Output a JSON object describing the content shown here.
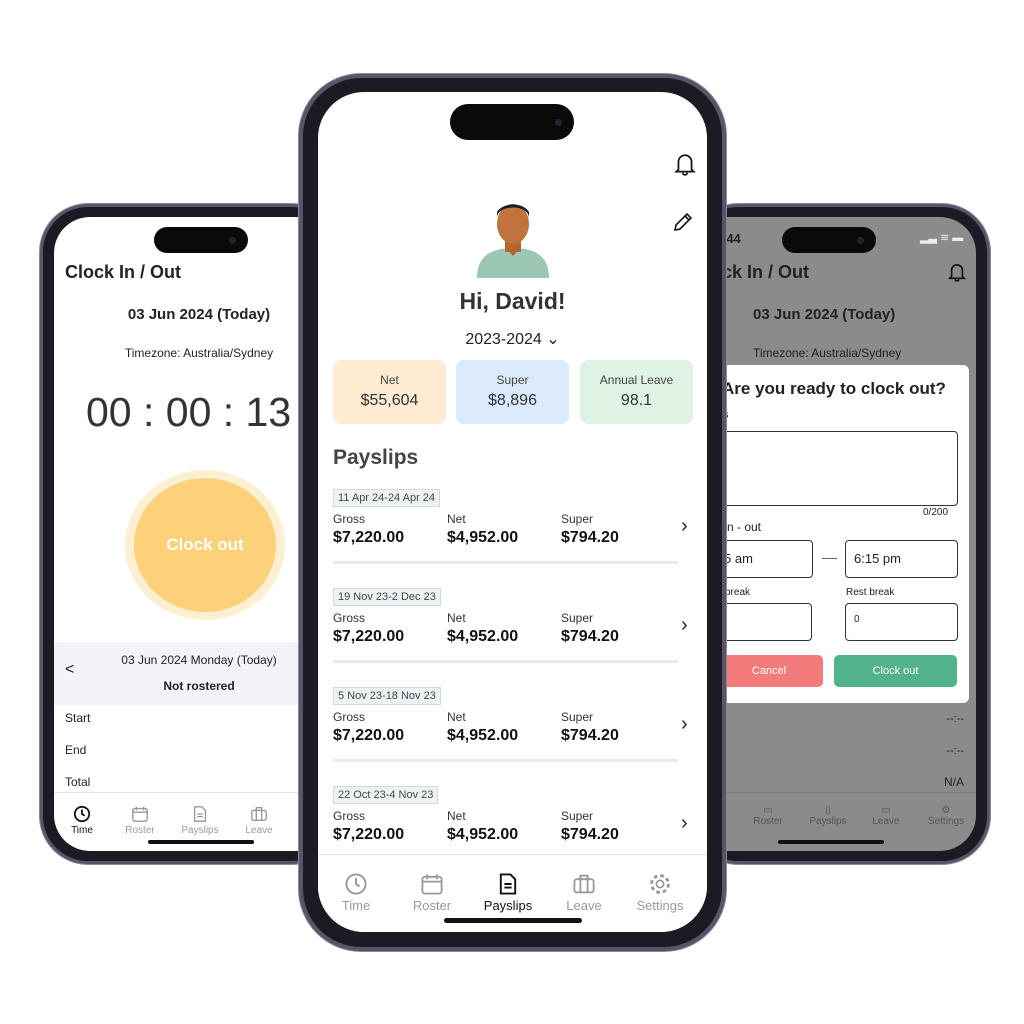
{
  "left_phone": {
    "title": "Clock In / Out",
    "date": "03 Jun 2024 (Today)",
    "timezone": "Timezone: Australia/Sydney",
    "timer": "00 : 00 : 13",
    "clock_button": "Clock out",
    "day_label": "03 Jun 2024 Monday (Today)",
    "roster_status": "Not rostered",
    "rows": [
      "Start",
      "End",
      "Total"
    ],
    "tabs": [
      {
        "label": "Time",
        "icon": "clock-icon",
        "active": true
      },
      {
        "label": "Roster",
        "icon": "calendar-icon"
      },
      {
        "label": "Payslips",
        "icon": "document-icon"
      },
      {
        "label": "Leave",
        "icon": "briefcase-icon"
      }
    ],
    "accent": "#fdd07a"
  },
  "center_phone": {
    "greeting": "Hi, David!",
    "year": "2023-2024",
    "cards": [
      {
        "label": "Net",
        "value": "$55,604",
        "color": "#fdecd2"
      },
      {
        "label": "Super",
        "value": "$8,896",
        "color": "#dcebfb"
      },
      {
        "label": "Annual Leave",
        "value": "98.1",
        "color": "#dff3e5"
      }
    ],
    "payslips_title": "Payslips",
    "column_labels": [
      "Gross",
      "Net",
      "Super"
    ],
    "payslips": [
      {
        "period": "11 Apr 24-24 Apr 24",
        "gross": "$7,220.00",
        "net": "$4,952.00",
        "super": "$794.20"
      },
      {
        "period": "19 Nov 23-2 Dec 23",
        "gross": "$7,220.00",
        "net": "$4,952.00",
        "super": "$794.20"
      },
      {
        "period": "5 Nov 23-18 Nov 23",
        "gross": "$7,220.00",
        "net": "$4,952.00",
        "super": "$794.20"
      },
      {
        "period": "22 Oct 23-4 Nov 23",
        "gross": "$7,220.00",
        "net": "$4,952.00",
        "super": "$794.20"
      }
    ],
    "tabs": [
      {
        "label": "Time",
        "icon": "clock-icon"
      },
      {
        "label": "Roster",
        "icon": "calendar-icon"
      },
      {
        "label": "Payslips",
        "icon": "document-icon",
        "active": true
      },
      {
        "label": "Leave",
        "icon": "briefcase-icon"
      },
      {
        "label": "Settings",
        "icon": "gear-icon"
      }
    ]
  },
  "right_phone": {
    "status_time": ":44",
    "title": "ck In / Out",
    "date": "03 Jun 2024 (Today)",
    "timezone": "Timezone: Australia/Sydney",
    "modal": {
      "title": "Are you ready to clock out?",
      "notes_label": "s",
      "counter": "0/200",
      "range_label": "k in - out",
      "start_time": "5 am",
      "end_time": "6:15 pm",
      "meal_label": "break",
      "rest_label": "Rest break",
      "rest_value": "0",
      "cancel": "Cancel",
      "confirm": "Clock out",
      "cancel_color": "#f47b7b",
      "confirm_color": "#52b28c"
    },
    "values": [
      "--:--",
      "--:--",
      "N/A"
    ],
    "tabs": [
      {
        "label": "Roster"
      },
      {
        "label": "Payslips"
      },
      {
        "label": "Leave"
      },
      {
        "label": "Settings"
      }
    ]
  }
}
